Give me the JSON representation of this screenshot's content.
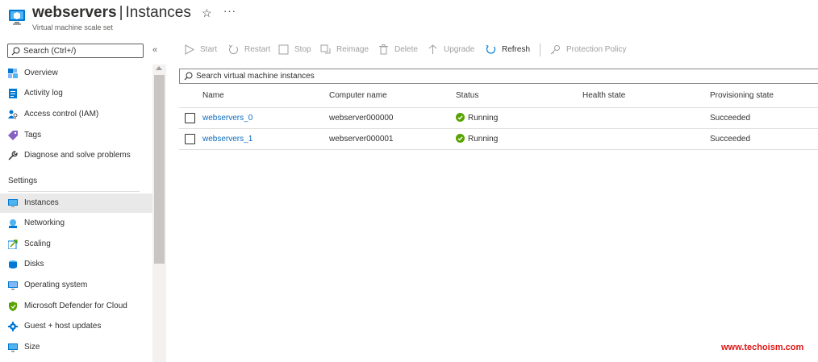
{
  "header": {
    "resource_name": "webservers",
    "separator": "|",
    "page_name": "Instances",
    "subtitle": "Virtual machine scale set",
    "star_glyph": "☆",
    "more_glyph": "···",
    "icon": "vmss-icon"
  },
  "sidebar": {
    "search_placeholder": "Search (Ctrl+/)",
    "collapse_glyph": "«",
    "items": [
      {
        "label": "Overview",
        "icon": "overview-icon"
      },
      {
        "label": "Activity log",
        "icon": "activity-log-icon"
      },
      {
        "label": "Access control (IAM)",
        "icon": "iam-icon"
      },
      {
        "label": "Tags",
        "icon": "tag-icon"
      },
      {
        "label": "Diagnose and solve problems",
        "icon": "wrench-icon"
      }
    ],
    "settings_heading": "Settings",
    "settings_items": [
      {
        "label": "Instances",
        "icon": "instances-icon",
        "active": true
      },
      {
        "label": "Networking",
        "icon": "networking-icon"
      },
      {
        "label": "Scaling",
        "icon": "scaling-icon"
      },
      {
        "label": "Disks",
        "icon": "disks-icon"
      },
      {
        "label": "Operating system",
        "icon": "monitor-icon"
      },
      {
        "label": "Microsoft Defender for Cloud",
        "icon": "shield-icon"
      },
      {
        "label": "Guest + host updates",
        "icon": "gear-icon"
      },
      {
        "label": "Size",
        "icon": "size-icon"
      }
    ]
  },
  "toolbar": {
    "start": "Start",
    "restart": "Restart",
    "stop": "Stop",
    "reimage": "Reimage",
    "delete": "Delete",
    "upgrade": "Upgrade",
    "refresh": "Refresh",
    "protection_policy": "Protection Policy"
  },
  "instances": {
    "search_placeholder": "Search virtual machine instances",
    "columns": [
      "Name",
      "Computer name",
      "Status",
      "Health state",
      "Provisioning state"
    ],
    "rows": [
      {
        "name": "webservers_0",
        "computer_name": "webserver000000",
        "status": "Running",
        "health": "",
        "provisioning": "Succeeded"
      },
      {
        "name": "webservers_1",
        "computer_name": "webserver000001",
        "status": "Running",
        "health": "",
        "provisioning": "Succeeded"
      }
    ]
  },
  "colors": {
    "accent": "#0f6cbd",
    "running": "#57a300",
    "watermark": "#e01616"
  },
  "watermark": "www.techoism.com"
}
